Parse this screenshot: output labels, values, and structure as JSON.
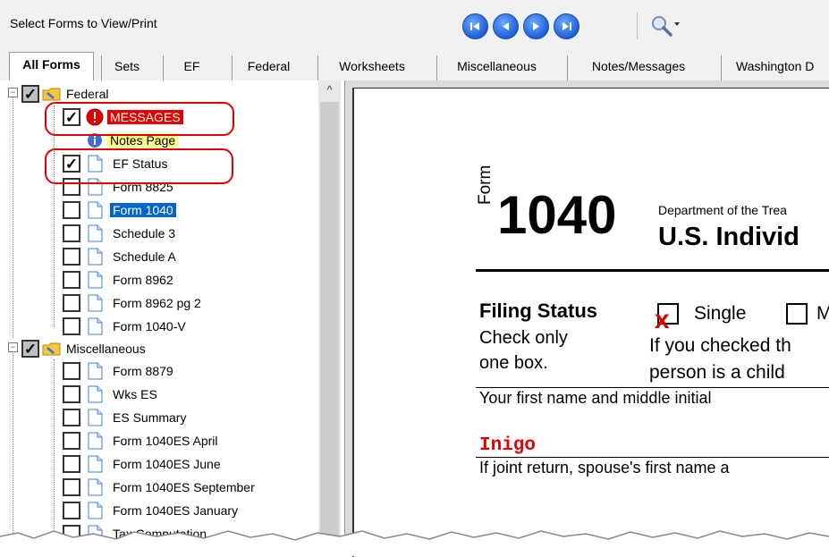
{
  "toolbar": {
    "title": "Select Forms to View/Print",
    "nav_buttons": [
      "first-icon",
      "previous-icon",
      "next-icon",
      "last-icon"
    ],
    "zoom_icon": "magnifier-icon"
  },
  "tabs": [
    "All Forms",
    "Sets",
    "EF",
    "Federal",
    "Worksheets",
    "Miscellaneous",
    "Notes/Messages",
    "Washington D"
  ],
  "tree": {
    "federal": "Federal",
    "federal_items": [
      "MESSAGES",
      "Notes Page",
      "EF Status",
      "Form 8825",
      "Form 1040",
      "Schedule 3",
      "Schedule A",
      "Form 8962",
      "Form 8962 pg 2",
      "Form 1040-V"
    ],
    "misc": "Miscellaneous",
    "misc_items": [
      "Form 8879",
      "Wks ES",
      "ES Summary",
      "Form 1040ES April",
      "Form 1040ES June",
      "Form 1040ES September",
      "Form 1040ES January",
      "Tax Computation"
    ]
  },
  "form": {
    "form_word": "Form",
    "number": "1040",
    "dept": "Department of the Trea",
    "heading": "U.S. Individ",
    "filing_status": "Filing Status",
    "check_only": "Check only",
    "one_box": "one box.",
    "single": "Single",
    "married_letter": "M",
    "checked_mark": "x",
    "if_checked": "If you checked th",
    "person_child": "person is a child",
    "first_name_label": "Your first name and middle initial",
    "first_name_value": "Inigo",
    "spouse_label": "If joint return, spouse's first name a"
  },
  "colors": {
    "accent": "#0066cc",
    "alert": "#e00000",
    "navBlue": "#1f5fd6",
    "filled": "#e00000"
  }
}
